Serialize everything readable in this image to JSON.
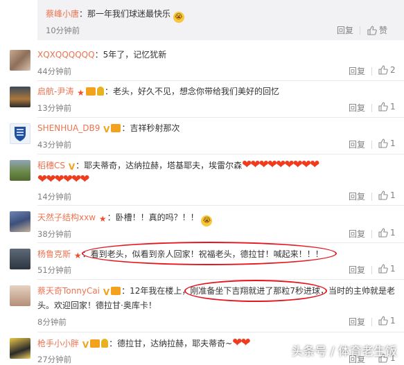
{
  "reply": {
    "user": "蔡峰小唐",
    "text": "：那一年我们球迷最快乐",
    "time": "10分钟前",
    "reply_label": "回复",
    "like_label": "赞"
  },
  "comments": [
    {
      "user": "XQXQQQQQQ",
      "text": "：5年了，记忆犹新",
      "time": "44分钟前",
      "reply_label": "回复",
      "likes": "2"
    },
    {
      "user": "启航-尹涛",
      "text": "：老头，好久不见，想念你带给我们美好的回忆",
      "time": "13分钟前",
      "reply_label": "回复",
      "likes": "1"
    },
    {
      "user": "SHENHUA_DB9",
      "text": "：吉祥秒射那次",
      "time": "43分钟前",
      "reply_label": "回复",
      "likes": "1"
    },
    {
      "user": "稻穗CS",
      "text": "：耶夫蒂奇，达纳拉赫，塔基耶夫，埃雷尔森",
      "time": "14分钟前",
      "reply_label": "回复",
      "likes": "1"
    },
    {
      "user": "天然子结构xxw",
      "text": "：卧槽！！真的吗？！！",
      "time": "38分钟前",
      "reply_label": "回复",
      "likes": "1"
    },
    {
      "user": "杨鲁克斯",
      "text": "：看到老头，似看到亲人回家！祝福老头，德拉甘！喊起来！！！",
      "time": "51分钟前",
      "reply_label": "回复",
      "likes": "1"
    },
    {
      "user": "蔡天奇TonnyCai",
      "text_line1": "：12年我在楼上，刚准备坐下吉翔就进了那粒7秒进球，当时的主帅就是老",
      "text_line2": "头。欢迎回家！德拉甘·奥库卡！",
      "time": "8分钟前",
      "reply_label": "回复",
      "likes": "1"
    },
    {
      "user": "枪手小小胖",
      "text": "：德拉甘，达纳拉赫，耶夫蒂奇~",
      "time": "27分钟前",
      "reply_label": "回复",
      "likes": "1"
    }
  ],
  "watermark": "头条号 / 体育老生饭",
  "colors": {
    "username": "#eb7350",
    "annotation_ring": "#e6161e",
    "heart": "#f03c1e"
  }
}
